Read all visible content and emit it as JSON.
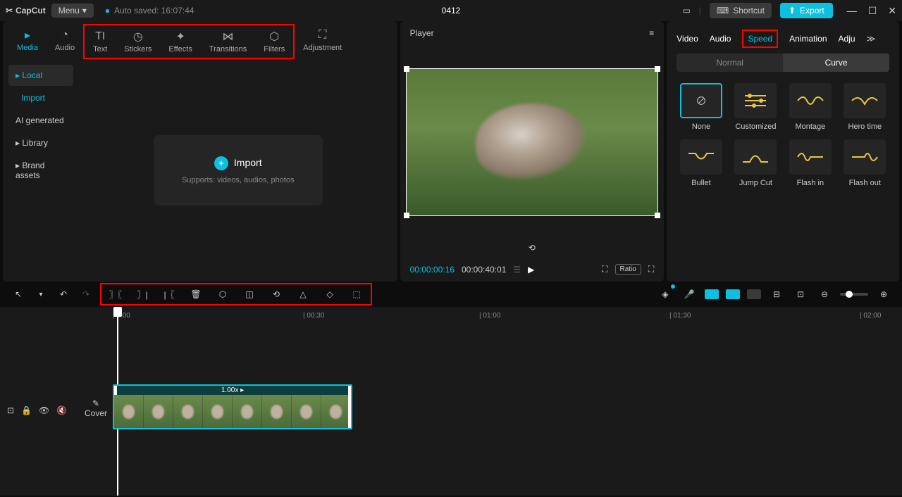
{
  "titlebar": {
    "app_name": "CapCut",
    "menu_label": "Menu",
    "autosave_label": "Auto saved: 16:07:44",
    "project_name": "0412",
    "shortcut_label": "Shortcut",
    "export_label": "Export"
  },
  "top_tabs": [
    {
      "label": "Media",
      "active": true
    },
    {
      "label": "Audio"
    },
    {
      "label": "Text"
    },
    {
      "label": "Stickers"
    },
    {
      "label": "Effects"
    },
    {
      "label": "Transitions"
    },
    {
      "label": "Filters"
    },
    {
      "label": "Adjustment"
    }
  ],
  "sidebar": {
    "items": [
      "Local",
      "Import",
      "AI generated",
      "Library",
      "Brand assets"
    ]
  },
  "import_box": {
    "label": "Import",
    "sub": "Supports: videos, audios, photos"
  },
  "player": {
    "title": "Player",
    "current": "00:00:00:16",
    "duration": "00:00:40:01",
    "ratio_label": "Ratio"
  },
  "right_panel": {
    "tabs": [
      "Video",
      "Audio",
      "Speed",
      "Animation",
      "Adju"
    ],
    "selected_tab": "Speed",
    "subtabs": {
      "a": "Normal",
      "b": "Curve"
    },
    "curves": [
      "None",
      "Customized",
      "Montage",
      "Hero time",
      "Bullet",
      "Jump Cut",
      "Flash in",
      "Flash out"
    ]
  },
  "timeline": {
    "marks": [
      "| 0:00",
      "| 00:30",
      "| 01:00",
      "| 01:30",
      "| 02:00"
    ],
    "clip_speed": "1.00x ▸",
    "cover_label": "Cover"
  }
}
